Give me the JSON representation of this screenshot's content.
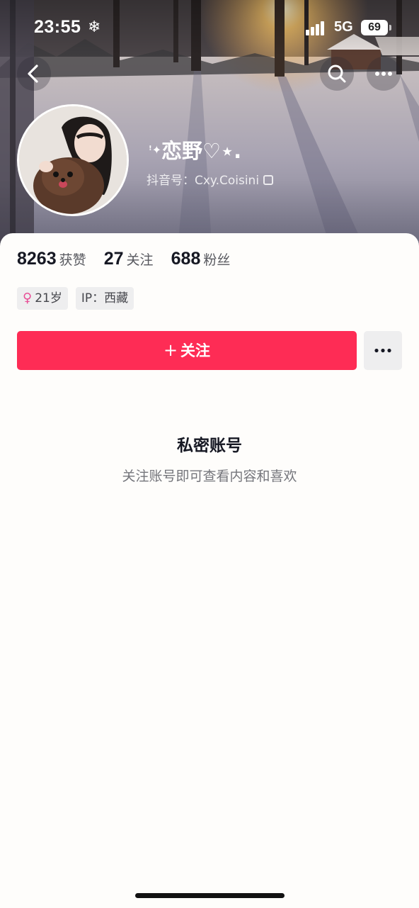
{
  "status_bar": {
    "time": "23:55",
    "weather_glyph": "❄",
    "network": "5G",
    "battery": "69"
  },
  "nav": {
    "back_icon": "chevron-left-icon",
    "search_icon": "search-icon",
    "more_icon": "more-horizontal-icon"
  },
  "profile": {
    "nickname_prefix": "ꜝ✦",
    "nickname": "恋野",
    "nickname_suffix": "♡⋆.",
    "douyin_id": "抖音号：Cxy.Coisini"
  },
  "stats": [
    {
      "num": "8263",
      "label": "获赞"
    },
    {
      "num": "27",
      "label": "关注"
    },
    {
      "num": "688",
      "label": "粉丝"
    }
  ],
  "tags": {
    "age": "21岁",
    "gender_glyph": "♀",
    "ip": "IP：西藏"
  },
  "actions": {
    "follow_plus": "+",
    "follow_label": "关注"
  },
  "private_notice": {
    "title": "私密账号",
    "description": "关注账号即可查看内容和喜欢"
  },
  "colors": {
    "accent": "#fe2c55",
    "tag_bg": "#eeeeef",
    "text_primary": "#161823",
    "text_secondary": "#74757b"
  }
}
